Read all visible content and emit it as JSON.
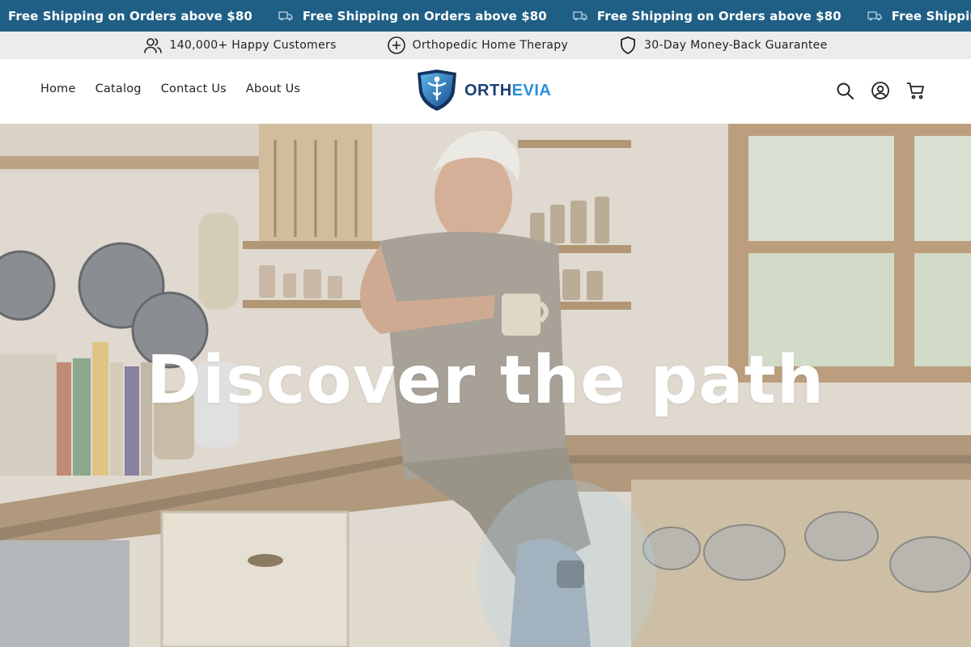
{
  "announcement": {
    "items": [
      "Free Shipping on Orders above $80",
      "Free Shipping on Orders above $80",
      "Free Shipping on Orders above $80",
      "Free Shipping on Orders above $80"
    ],
    "icon": "truck-icon",
    "background": "#1f5f86"
  },
  "trust_bar": {
    "items": [
      {
        "icon": "users-icon",
        "label": "140,000+ Happy Customers"
      },
      {
        "icon": "plus-circle-icon",
        "label": "Orthopedic Home Therapy"
      },
      {
        "icon": "shield-icon",
        "label": "30-Day Money-Back Guarantee"
      }
    ]
  },
  "nav": {
    "items": [
      "Home",
      "Catalog",
      "Contact Us",
      "About Us"
    ]
  },
  "logo": {
    "text_part1": "ORTH",
    "text_part2": "EVIA",
    "color_dark": "#1a3f74",
    "color_light": "#2b8fd6"
  },
  "header_icons": [
    "search-icon",
    "account-icon",
    "cart-icon"
  ],
  "hero": {
    "title": "Discover the path"
  }
}
